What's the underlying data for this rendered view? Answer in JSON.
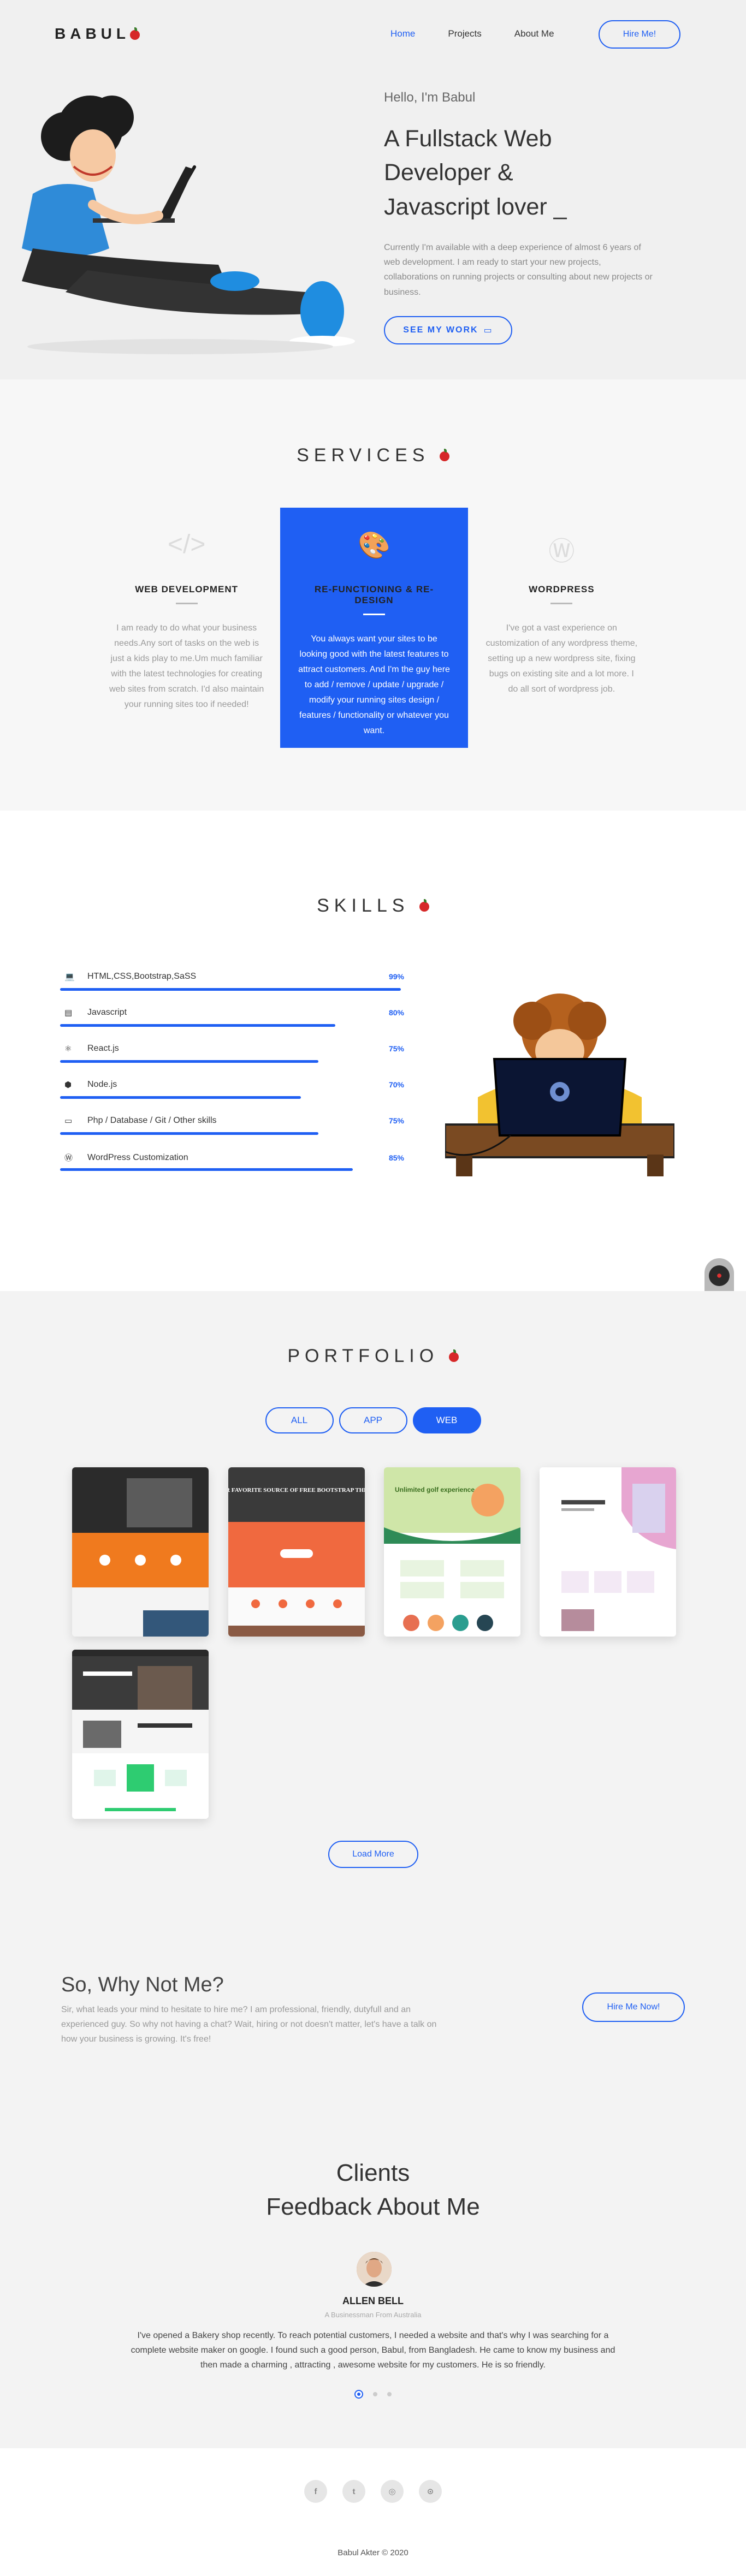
{
  "header": {
    "logo_text": "BABUL",
    "nav": [
      "Home",
      "Projects",
      "About Me"
    ],
    "hire_button": "Hire Me!"
  },
  "hero": {
    "greeting": "Hello, I'm Babul",
    "headline_line1": "A Fullstack Web",
    "headline_line2": "Developer &",
    "headline_line3": "Javascript lover _",
    "description": "Currently I'm available with a deep experience of almost 6 years of web development. I am ready to start your new projects, collaborations on running projects or consulting about new projects or business.",
    "cta": "SEE MY WORK"
  },
  "services": {
    "title": "SERVICES",
    "items": [
      {
        "icon": "code-icon",
        "glyph": "</>",
        "title": "WEB DEVELOPMENT",
        "desc": "I am ready to do what your business needs.Any sort of tasks on the web is just a kids play to me.Um much familiar with the latest technologies for creating web sites from scratch. I'd also maintain your running sites too if needed!"
      },
      {
        "icon": "palette-icon",
        "glyph": "🎨",
        "title": "RE-FUNCTIONING & RE-DESIGN",
        "desc": "You always want your sites to be looking good with the latest features to attract customers. And I'm the guy here to add / remove / update / upgrade / modify your running sites design / features / functionality or whatever you want."
      },
      {
        "icon": "wordpress-icon",
        "glyph": "Ⓦ",
        "title": "WORDPRESS",
        "desc": "I've got a vast experience on customization of any wordpress theme, setting up a new wordpress site, fixing bugs on existing site and a lot more. I do all sort of wordpress job."
      }
    ]
  },
  "skills": {
    "title": "SKILLS",
    "items": [
      {
        "icon": "laptop-icon",
        "glyph": "💻",
        "name": "HTML,CSS,Bootstrap,SaSS",
        "percent_label": "99%",
        "value": 99
      },
      {
        "icon": "file-icon",
        "glyph": "▤",
        "name": "Javascript",
        "percent_label": "80%",
        "value": 80
      },
      {
        "icon": "atom-icon",
        "glyph": "⚛",
        "name": "React.js",
        "percent_label": "75%",
        "value": 75
      },
      {
        "icon": "node-icon",
        "glyph": "⬢",
        "name": "Node.js",
        "percent_label": "70%",
        "value": 70
      },
      {
        "icon": "database-icon",
        "glyph": "▭",
        "name": "Php / Database / Git / Other skills",
        "percent_label": "75%",
        "value": 75
      },
      {
        "icon": "wordpress-icon",
        "glyph": "Ⓦ",
        "name": "WordPress Customization",
        "percent_label": "85%",
        "value": 85
      }
    ]
  },
  "portfolio": {
    "title": "PORTFOLIO",
    "filters": [
      "ALL",
      "APP",
      "WEB"
    ],
    "active_filter": 2,
    "works": [
      {
        "caption": ""
      },
      {
        "caption": "YOUR FAVORITE SOURCE OF FREE BOOTSTRAP THEMES"
      },
      {
        "caption": "Unlimited golf experience"
      },
      {
        "caption": ""
      },
      {
        "caption": ""
      }
    ],
    "load_more": "Load More"
  },
  "why": {
    "title": "So, Why Not Me?",
    "desc": "Sir, what leads your mind to hesitate to hire me? I am professional, friendly, dutyfull and an experienced guy. So why not having a chat? Wait, hiring or not doesn't matter, let's have a talk on how your business is growing. It's free!",
    "button": "Hire Me Now!"
  },
  "clients": {
    "title_line1": "Clients",
    "title_line2": "Feedback About Me",
    "name": "ALLEN BELL",
    "role": "A Businessman From Australia",
    "quote": "I've opened a Bakery shop recently. To reach potential customers, I needed a website and that's why I was searching for a complete website maker on google. I found such a good person, Babul, from Bangladesh. He came to know my business and then made a charming , attracting , awesome website for my customers. He is so friendly."
  },
  "footer": {
    "socials": [
      {
        "icon": "facebook-icon",
        "glyph": "f"
      },
      {
        "icon": "twitter-icon",
        "glyph": "t"
      },
      {
        "icon": "instagram-icon",
        "glyph": "◎"
      },
      {
        "icon": "github-icon",
        "glyph": "⊙"
      }
    ],
    "copyright": "Babul Akter © 2020"
  },
  "colors": {
    "accent": "#1f5ff3",
    "apple": "#d62828",
    "bg_light": "#f0f0f0"
  }
}
